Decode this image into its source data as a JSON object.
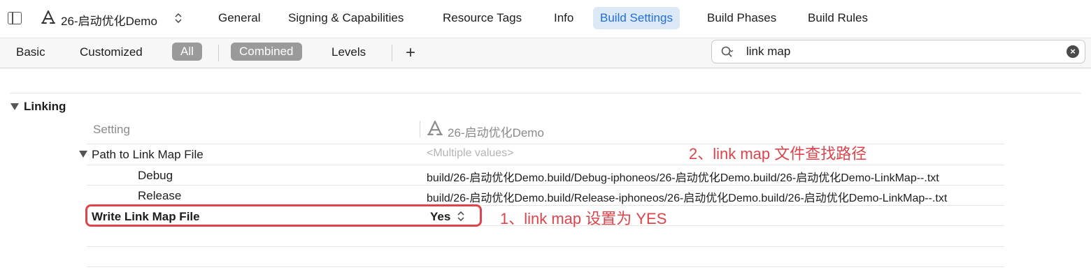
{
  "header": {
    "project_name": "26-启动优化Demo",
    "tabs": [
      {
        "label": "General"
      },
      {
        "label": "Signing & Capabilities"
      },
      {
        "label": "Resource Tags"
      },
      {
        "label": "Info"
      },
      {
        "label": "Build Settings",
        "active": true
      },
      {
        "label": "Build Phases"
      },
      {
        "label": "Build Rules"
      }
    ]
  },
  "filter_bar": {
    "scope": [
      "Basic",
      "Customized",
      "All"
    ],
    "view": [
      "Combined",
      "Levels"
    ],
    "selected_scope": "All",
    "selected_view": "Combined",
    "search_value": "link map"
  },
  "settings": {
    "section_title": "Linking",
    "column_setting": "Setting",
    "column_target": "26-启动优化Demo",
    "rows": [
      {
        "name": "Path to Link Map File",
        "value": "<Multiple values>"
      },
      {
        "name": "Debug",
        "value": "build/26-启动优化Demo.build/Debug-iphoneos/26-启动优化Demo.build/26-启动优化Demo-LinkMap--.txt"
      },
      {
        "name": "Release",
        "value": "build/26-启动优化Demo.build/Release-iphoneos/26-启动优化Demo.build/26-启动优化Demo-LinkMap--.txt"
      },
      {
        "name": "Write Link Map File",
        "value": "Yes"
      }
    ]
  },
  "annotations": {
    "a1": "1、link map 设置为 YES",
    "a2": "2、link map 文件查找路径"
  },
  "colors": {
    "accent": "#1f6fe0",
    "annotation_red": "#e0434b",
    "pill_gray": "#9a9a9a"
  }
}
